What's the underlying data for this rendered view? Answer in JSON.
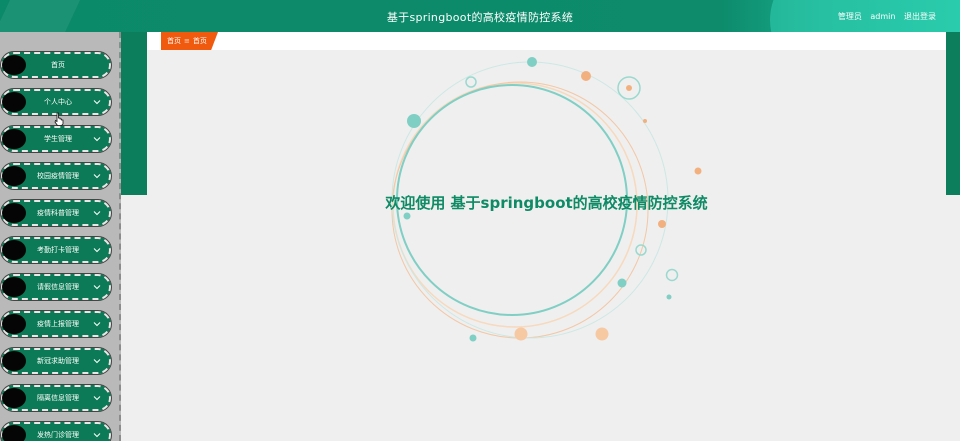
{
  "header": {
    "title": "基于springboot的高校疫情防控系统",
    "role": "管理员",
    "username": "admin",
    "logout_label": "退出登录"
  },
  "breadcrumb": {
    "home_label": "首页",
    "separator": "≡",
    "current": "首页"
  },
  "sidebar": {
    "items": [
      {
        "label": "首页",
        "has_chevron": false
      },
      {
        "label": "个人中心",
        "has_chevron": true
      },
      {
        "label": "学生管理",
        "has_chevron": true
      },
      {
        "label": "校园疫情管理",
        "has_chevron": true
      },
      {
        "label": "疫情科普管理",
        "has_chevron": true
      },
      {
        "label": "考勤打卡管理",
        "has_chevron": true
      },
      {
        "label": "请假信息管理",
        "has_chevron": true
      },
      {
        "label": "疫情上报管理",
        "has_chevron": true
      },
      {
        "label": "新冠求助管理",
        "has_chevron": true
      },
      {
        "label": "隔离信息管理",
        "has_chevron": true
      },
      {
        "label": "发热门诊管理",
        "has_chevron": true
      }
    ]
  },
  "main": {
    "welcome_text": "欢迎使用 基于springboot的高校疫情防控系统"
  },
  "colors": {
    "primary": "#0c7e5c",
    "accent": "#f05a0f",
    "welcome_text": "#0e8a64"
  }
}
